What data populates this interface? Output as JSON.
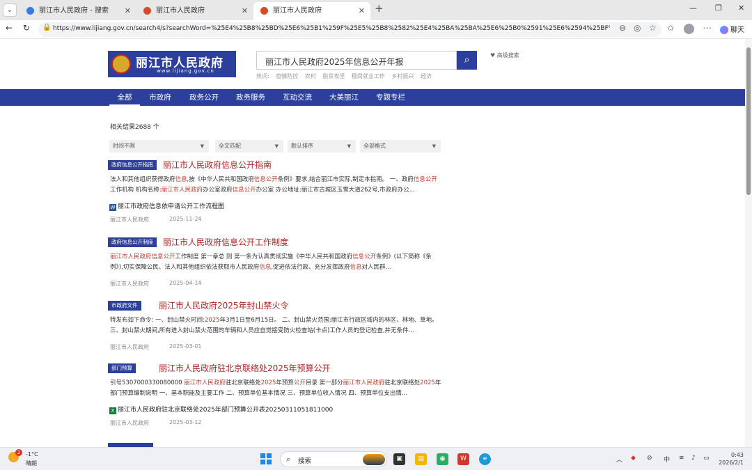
{
  "browser": {
    "tabs": [
      {
        "label": "丽江市人民政府 - 搜索",
        "active": false,
        "icon": "search-favicon"
      },
      {
        "label": "丽江市人民政府",
        "active": false,
        "icon": "gov-favicon"
      },
      {
        "label": "丽江市人民政府",
        "active": true,
        "icon": "gov-favicon"
      }
    ],
    "url": "https://www.lijiang.gov.cn/search4/s?searchWord=%25E4%25B8%25BD%25E6%25B1%259F%25E5%25B8%2582%25E4%25BA%25BA%25E6%25B0%2591%25E6%2594%25BF%25E5%2...",
    "chat_label": "聊天"
  },
  "site": {
    "logo_name": "丽江市人民政府",
    "logo_domain": "www.lijiang.gov.cn",
    "search_query": "丽江市人民政府2025年信息公开年报",
    "advanced_search": "高级搜索",
    "hot_label": "热词:",
    "hot_words": [
      "疫情防控",
      "农村",
      "脱贫攻坚",
      "稳岗就业工作",
      "乡村振兴",
      "经济"
    ],
    "nav": [
      "全部",
      "市政府",
      "政务公开",
      "政务服务",
      "互动交流",
      "大美丽江",
      "专题专栏"
    ],
    "nav_active": "全部"
  },
  "results_header": {
    "count_text": "相关结果2688 个",
    "filters": [
      "时间不限",
      "全文匹配",
      "默认排序",
      "全部格式"
    ]
  },
  "results": [
    {
      "tag": "政府信息公开指南",
      "title": "丽江市人民政府信息公开指南",
      "summary": [
        {
          "t": "法人和其他组织获得政府",
          "h": false
        },
        {
          "t": "信息",
          "h": true
        },
        {
          "t": ",按《中华人民共和国政府",
          "h": false
        },
        {
          "t": "信息公开",
          "h": true
        },
        {
          "t": "条例》要求,结合丽江市实际,制定本指南。 一、政府",
          "h": false
        },
        {
          "t": "信息公开",
          "h": true
        },
        {
          "t": "工作机构 机构名称:",
          "h": false
        },
        {
          "t": "丽江市人民政府",
          "h": true
        },
        {
          "t": "办公室政府",
          "h": false
        },
        {
          "t": "信息公开",
          "h": true
        },
        {
          "t": "办公室 办公地址:丽江市古城区玉雪大道262号,市政府办公...",
          "h": false
        }
      ],
      "attachment": {
        "type": "word",
        "label": "丽江市政府信息依申请公开工作流程图"
      },
      "source": "丽江市人民政府",
      "date": "2025-11-24"
    },
    {
      "tag": "政府信息公开制度",
      "title": "丽江市人民政府信息公开工作制度",
      "summary": [
        {
          "t": "丽江市人民政府信息公开",
          "h": true
        },
        {
          "t": "工作制度 第一章总 则 第一条为认真贯彻实施《中华人民共和国政府",
          "h": false
        },
        {
          "t": "信息公开",
          "h": true
        },
        {
          "t": "条例》(以下简称《条例》),切实保障公民、法人和其他组织依法获取市人民政府",
          "h": false
        },
        {
          "t": "信息",
          "h": true
        },
        {
          "t": ",促进依法行政、充分发挥政府",
          "h": false
        },
        {
          "t": "信息",
          "h": true
        },
        {
          "t": "对人民群...",
          "h": false
        }
      ],
      "attachment": null,
      "source": "丽江市人民政府",
      "date": "2025-04-14"
    },
    {
      "tag": "市政府文件",
      "title": "丽江市人民政府2025年封山禁火令",
      "summary": [
        {
          "t": "特发布如下命令: 一、封山禁火时间:",
          "h": false
        },
        {
          "t": "2025",
          "h": true
        },
        {
          "t": "年3月1日至6月15日。 二、封山禁火范围:丽江市行政区域内的林区、林地、草地。 三、封山禁火期间,所有进入封山禁火范围的车辆和人员应自觉接受防火检查站(卡点)工作人员的登记检查,并无条件...",
          "h": false
        }
      ],
      "attachment": null,
      "source": "丽江市人民政府",
      "date": "2025-03-01"
    },
    {
      "tag": "部门预算",
      "title": "丽江市人民政府驻北京联络处2025年预算公开",
      "summary": [
        {
          "t": "引号5307000330080000 ",
          "h": false
        },
        {
          "t": "丽江市人民政府",
          "h": true
        },
        {
          "t": "驻北京联络处",
          "h": false
        },
        {
          "t": "2025",
          "h": true
        },
        {
          "t": "年预算",
          "h": false
        },
        {
          "t": "公开",
          "h": true
        },
        {
          "t": "目录 第一部分",
          "h": false
        },
        {
          "t": "丽江市人民政府",
          "h": true
        },
        {
          "t": "驻北京联络处",
          "h": false
        },
        {
          "t": "2025",
          "h": true
        },
        {
          "t": "年部门预算编制说明 一、基本职能及主要工作 二、预算单位基本情况 三、预算单位收入情况 四、预算单位支出情...",
          "h": false
        }
      ],
      "attachment": {
        "type": "excel",
        "label": "丽江市人民政府驻北京联络处2025年部门预算公开表20250311051811000"
      },
      "source": "丽江市人民政府",
      "date": "2025-03-12"
    }
  ],
  "taskbar": {
    "weather_temp": "-1°C",
    "weather_desc": "晴朗",
    "weather_badge": "2",
    "search_label": "搜索",
    "ime": "中",
    "time": "0:43",
    "date": "2026/2/1"
  }
}
